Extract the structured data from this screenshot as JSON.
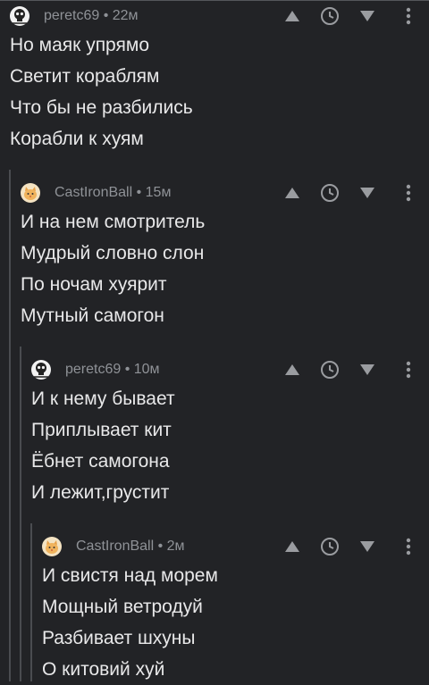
{
  "comments": [
    {
      "author": "peretc69",
      "time": "22м",
      "meta": "peretc69 • 22м",
      "avatar_icon": "skull-avatar-icon",
      "lines": [
        "Но маяк упрямо",
        "Светит кораблям",
        "Что бы не разбились",
        "Корабли к хуям"
      ]
    },
    {
      "author": "CastIronBall",
      "time": "15м",
      "meta": "CastIronBall • 15м",
      "avatar_icon": "cat-avatar-icon",
      "lines": [
        "И на нем смотритель",
        "Мудрый словно слон",
        "По ночам хуярит",
        "Мутный самогон"
      ]
    },
    {
      "author": "peretc69",
      "time": "10м",
      "meta": "peretc69 • 10м",
      "avatar_icon": "skull-avatar-icon",
      "lines": [
        "И к нему бывает",
        "Приплывает кит",
        "Ёбнет самогона",
        "И лежит,грустит"
      ]
    },
    {
      "author": "CastIronBall",
      "time": "2м",
      "meta": "CastIronBall • 2м",
      "avatar_icon": "cat-avatar-icon",
      "lines": [
        "И свистя над морем",
        "Мощный ветродуй",
        "Разбивает шхуны",
        "О китовий хуй"
      ]
    }
  ],
  "actions": [
    "upvote-icon",
    "clock-icon",
    "downvote-icon",
    "more-icon"
  ],
  "colors": {
    "background": "#222326",
    "text": "#e8e8e9",
    "meta": "#8f9297",
    "icon": "#9a9ca0",
    "thread": "#4a4c50"
  }
}
